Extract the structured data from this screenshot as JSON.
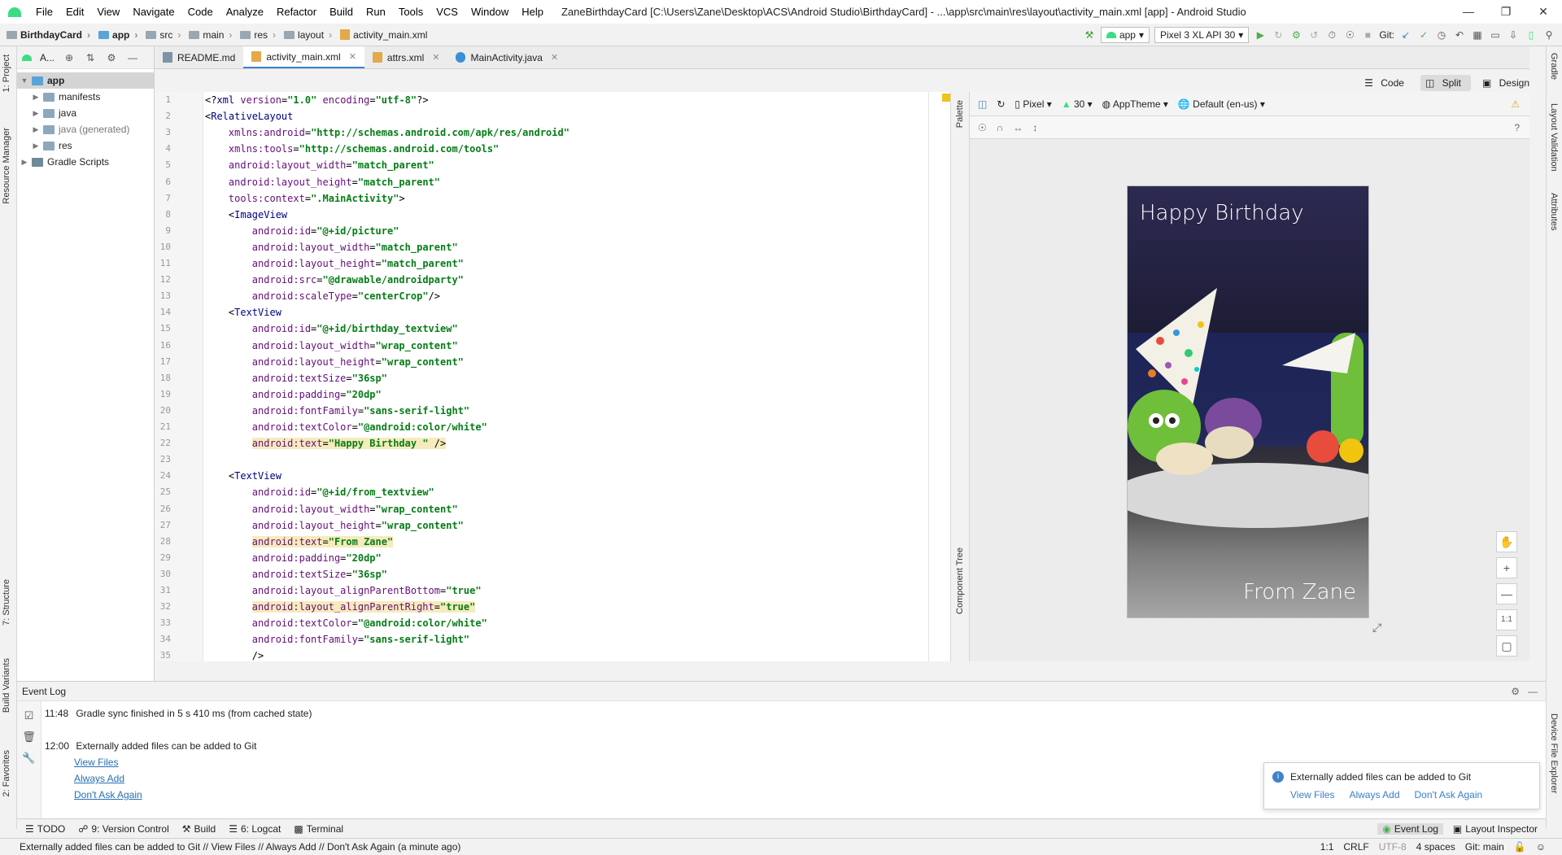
{
  "titlebar": {
    "menus": [
      "File",
      "Edit",
      "View",
      "Navigate",
      "Code",
      "Analyze",
      "Refactor",
      "Build",
      "Run",
      "Tools",
      "VCS",
      "Window",
      "Help"
    ],
    "title": "ZaneBirthdayCard [C:\\Users\\Zane\\Desktop\\ACS\\Android Studio\\BirthdayCard] - ...\\app\\src\\main\\res\\layout\\activity_main.xml [app] - Android Studio"
  },
  "breadcrumbs": [
    "BirthdayCard",
    "app",
    "src",
    "main",
    "res",
    "layout",
    "activity_main.xml"
  ],
  "toolbar": {
    "run_config": "app",
    "device": "Pixel 3 XL API 30",
    "git_label": "Git:"
  },
  "left_tabs": [
    "1: Project",
    "Resource Manager",
    "7: Structure",
    "Build Variants",
    "2: Favorites"
  ],
  "right_tabs": [
    "Gradle",
    "Layout Validation",
    "Attributes",
    "Device File Explorer"
  ],
  "project": {
    "header": "A...",
    "tree": [
      {
        "label": "app",
        "level": 0,
        "type": "module"
      },
      {
        "label": "manifests",
        "level": 1,
        "type": "folder"
      },
      {
        "label": "java",
        "level": 1,
        "type": "folder"
      },
      {
        "label": "java (generated)",
        "level": 1,
        "type": "folder"
      },
      {
        "label": "res",
        "level": 1,
        "type": "folder"
      },
      {
        "label": "Gradle Scripts",
        "level": 0,
        "type": "gradle"
      }
    ]
  },
  "tabs": [
    {
      "label": "README.md",
      "active": false
    },
    {
      "label": "activity_main.xml",
      "active": true
    },
    {
      "label": "attrs.xml",
      "active": false
    },
    {
      "label": "MainActivity.java",
      "active": false
    }
  ],
  "view_modes": [
    "Code",
    "Split",
    "Design"
  ],
  "code": [
    "<?xml version=\"1.0\" encoding=\"utf-8\"?>",
    "<RelativeLayout",
    "    xmlns:android=\"http://schemas.android.com/apk/res/android\"",
    "    xmlns:tools=\"http://schemas.android.com/tools\"",
    "    android:layout_width=\"match_parent\"",
    "    android:layout_height=\"match_parent\"",
    "    tools:context=\".MainActivity\">",
    "    <ImageView",
    "        android:id=\"@+id/picture\"",
    "        android:layout_width=\"match_parent\"",
    "        android:layout_height=\"match_parent\"",
    "        android:src=\"@drawable/androidparty\"",
    "        android:scaleType=\"centerCrop\"/>",
    "    <TextView",
    "        android:id=\"@+id/birthday_textview\"",
    "        android:layout_width=\"wrap_content\"",
    "        android:layout_height=\"wrap_content\"",
    "        android:textSize=\"36sp\"",
    "        android:padding=\"20dp\"",
    "        android:fontFamily=\"sans-serif-light\"",
    "        android:textColor=\"@android:color/white\"",
    "        android:text=\"Happy Birthday \" />",
    "",
    "    <TextView",
    "        android:id=\"@+id/from_textview\"",
    "        android:layout_width=\"wrap_content\"",
    "        android:layout_height=\"wrap_content\"",
    "        android:text=\"From Zane\"",
    "        android:padding=\"20dp\"",
    "        android:textSize=\"36sp\"",
    "        android:layout_alignParentBottom=\"true\"",
    "        android:layout_alignParentRight=\"true\"",
    "        android:textColor=\"@android:color/white\"",
    "        android:fontFamily=\"sans-serif-light\"",
    "        />"
  ],
  "highlight_lines": [
    22,
    28,
    32
  ],
  "palette_tabs": [
    "Palette",
    "Component Tree"
  ],
  "design": {
    "device": "Pixel",
    "api": "30",
    "theme": "AppTheme",
    "locale": "Default (en-us)",
    "birthday_text": "Happy Birthday",
    "from_text": "From Zane",
    "zoom_label": "1:1"
  },
  "eventlog": {
    "title": "Event Log",
    "entries": [
      {
        "time": "11:48",
        "text": "Gradle sync finished in 5 s 410 ms (from cached state)"
      },
      {
        "time": "12:00",
        "text": "Externally added files can be added to Git"
      }
    ],
    "links": [
      "View Files",
      "Always Add",
      "Don't Ask Again"
    ]
  },
  "notification": {
    "text": "Externally added files can be added to Git",
    "links": [
      "View Files",
      "Always Add",
      "Don't Ask Again"
    ]
  },
  "bottom_tools": [
    "TODO",
    "9: Version Control",
    "Build",
    "6: Logcat",
    "Terminal"
  ],
  "bottom_right_tools": [
    "Event Log",
    "Layout Inspector"
  ],
  "status": {
    "message": "Externally added files can be added to Git // View Files // Always Add // Don't Ask Again (a minute ago)",
    "position": "1:1",
    "line_sep": "CRLF",
    "encoding": "UTF-8",
    "indent": "4 spaces",
    "branch": "Git: main"
  },
  "colors": {
    "accent": "#4083c9",
    "android_green": "#3ddc84",
    "xml_tag": "#000080",
    "xml_attr": "#660e7a",
    "xml_value": "#067d17"
  }
}
